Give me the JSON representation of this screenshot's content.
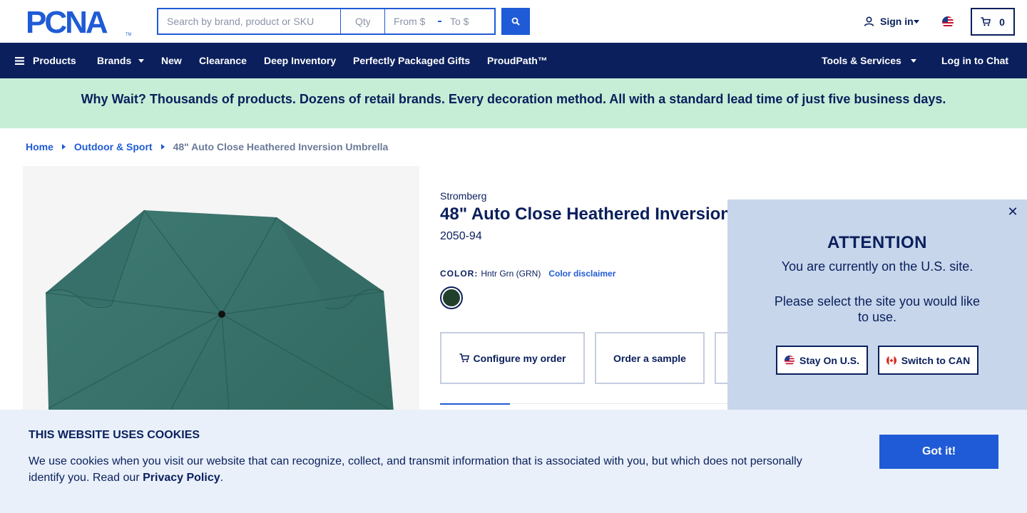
{
  "header": {
    "logo_text": "PCNA",
    "search_placeholder": "Search by brand, product or SKU",
    "qty_placeholder": "Qty",
    "price_from_placeholder": "From $",
    "price_to_placeholder": "To $",
    "signin_label": "Sign in",
    "cart_count": "0"
  },
  "nav": {
    "products": "Products",
    "brands": "Brands",
    "new": "New",
    "clearance": "Clearance",
    "deep_inventory": "Deep Inventory",
    "gifts": "Perfectly Packaged Gifts",
    "proudpath": "ProudPath™",
    "tools": "Tools & Services",
    "chat": "Log in to Chat"
  },
  "promo": {
    "text": "Why Wait? Thousands of products. Dozens of retail brands. Every decoration method. All with a standard lead time of just five business days."
  },
  "breadcrumb": {
    "home": "Home",
    "category": "Outdoor & Sport",
    "current": "48\" Auto Close Heathered Inversion Umbrella"
  },
  "product": {
    "brand": "Stromberg",
    "title": "48\" Auto Close Heathered Inversion",
    "sku": "2050-94",
    "color_label": "COLOR:",
    "color_value": "Hntr Grn (GRN)",
    "color_disclaimer": "Color disclaimer",
    "swatch_color": "#21402c",
    "configure_label": "Configure my order",
    "sample_label": "Order a sample"
  },
  "modal": {
    "title": "ATTENTION",
    "line1": "You are currently on the U.S. site.",
    "line2": "Please select the site you would like to use.",
    "stay_label": "Stay On U.S.",
    "switch_label": "Switch to CAN"
  },
  "cookie": {
    "title": "THIS WEBSITE USES COOKIES",
    "text": "We use cookies when you visit our website that can recognize, collect, and transmit information that is associated with you, but which does not personally identify you. Read our ",
    "link": "Privacy Policy",
    "period": ".",
    "button": "Got it!"
  },
  "colors": {
    "navy": "#0a1f5c",
    "accent": "#1f5bd6",
    "promo_bg": "#c6eed6",
    "modal_bg": "#c7d6eb",
    "cookie_bg": "#e9f0fa"
  }
}
